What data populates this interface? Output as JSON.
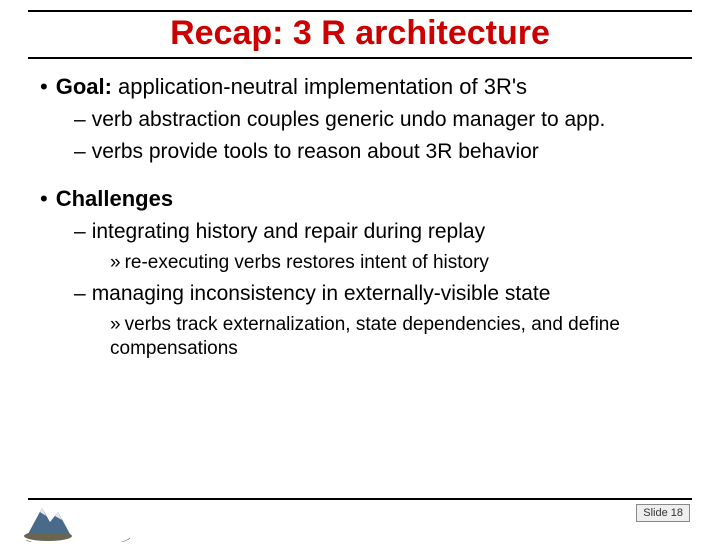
{
  "title": "Recap: 3 R architecture",
  "goal": {
    "lead": "Goal:",
    "rest": " application-neutral implementation of 3R's",
    "sub1": "verb abstraction couples generic undo manager to app.",
    "sub2": "verbs provide tools to reason about 3R behavior"
  },
  "challenges": {
    "lead": "Challenges",
    "c1": "integrating history and repair during replay",
    "c1a": "re-executing verbs restores intent of history",
    "c2": "managing inconsistency in externally-visible state",
    "c2a": "verbs track externalization, state dependencies, and define compensations"
  },
  "slide_label": "Slide 18",
  "bullets": {
    "dot": "•",
    "dash": "–",
    "arrow": "»"
  }
}
